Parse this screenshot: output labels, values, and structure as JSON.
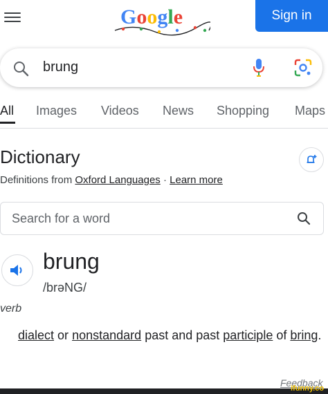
{
  "header": {
    "signin_label": "Sign in",
    "logo_letters": [
      "G",
      "o",
      "o",
      "g",
      "l",
      "e"
    ],
    "logo_colors": [
      "#4285f4",
      "#ea4335",
      "#fbbc05",
      "#4285f4",
      "#34a853",
      "#ea4335"
    ]
  },
  "search": {
    "query": "brung"
  },
  "tabs": [
    {
      "label": "All",
      "active": true
    },
    {
      "label": "Images",
      "active": false
    },
    {
      "label": "Videos",
      "active": false
    },
    {
      "label": "News",
      "active": false
    },
    {
      "label": "Shopping",
      "active": false
    },
    {
      "label": "Maps",
      "active": false
    }
  ],
  "dictionary": {
    "title": "Dictionary",
    "definitions_from": "Definitions from",
    "source": "Oxford Languages",
    "separator": "·",
    "learn_more": "Learn more",
    "search_placeholder": "Search for a word",
    "headword": "brung",
    "pronunciation": "/brəNG/",
    "part_of_speech": "verb",
    "definition": {
      "word1": "dialect",
      "or": "or",
      "word2": "nonstandard",
      "middle": "past and past",
      "word3": "participle",
      "of": "of",
      "word4": "bring",
      "end": "."
    }
  },
  "footer": {
    "feedback": "Feedback",
    "watermark": "ifunny.co"
  },
  "colors": {
    "accent": "#1a73e8",
    "text": "#202124",
    "muted": "#5f6368"
  }
}
